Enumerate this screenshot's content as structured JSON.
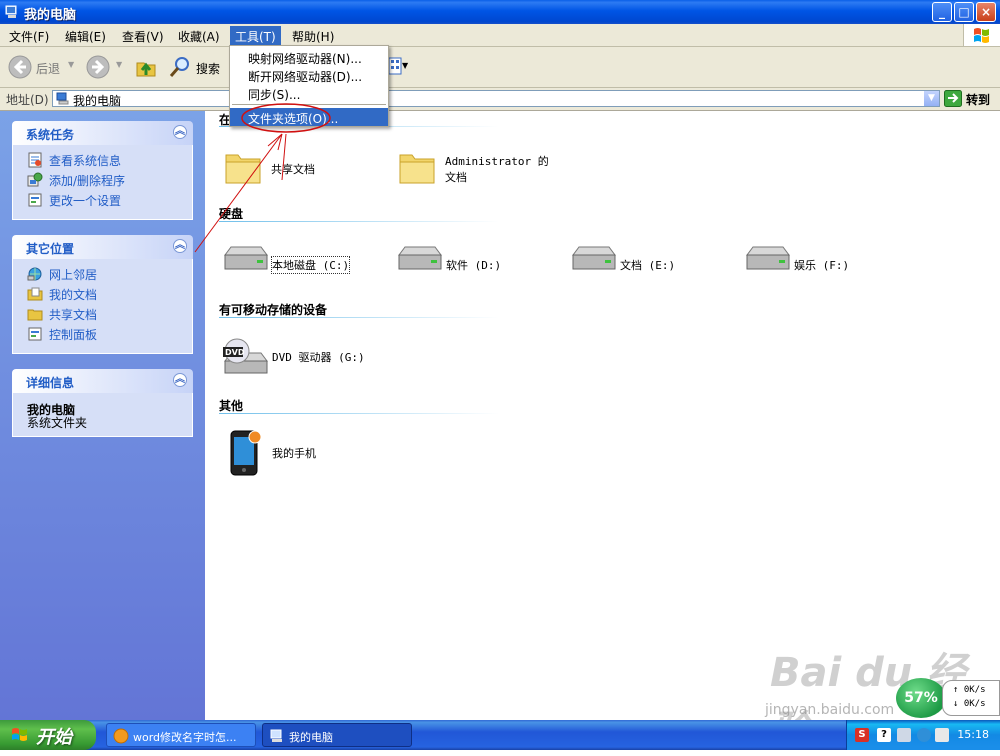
{
  "window": {
    "title": "我的电脑"
  },
  "menu": {
    "items": [
      {
        "label": "文件(F)"
      },
      {
        "label": "编辑(E)"
      },
      {
        "label": "查看(V)"
      },
      {
        "label": "收藏(A)"
      },
      {
        "label": "工具(T)"
      },
      {
        "label": "帮助(H)"
      }
    ]
  },
  "toolbar": {
    "back_label": "后退",
    "search_label": "搜索"
  },
  "address": {
    "label": "地址(D)",
    "value": "我的电脑",
    "go_label": "转到"
  },
  "tools_menu": {
    "items": [
      {
        "label": "映射网络驱动器(N)..."
      },
      {
        "label": "断开网络驱动器(D)..."
      },
      {
        "label": "同步(S)..."
      },
      {
        "label": "文件夹选项(O)..."
      }
    ],
    "highlighted_index": 3
  },
  "sidebar": {
    "system_tasks": {
      "title": "系统任务",
      "items": [
        {
          "label": "查看系统信息"
        },
        {
          "label": "添加/删除程序"
        },
        {
          "label": "更改一个设置"
        }
      ]
    },
    "other_places": {
      "title": "其它位置",
      "items": [
        {
          "label": "网上邻居"
        },
        {
          "label": "我的文档"
        },
        {
          "label": "共享文档"
        },
        {
          "label": "控制面板"
        }
      ]
    },
    "details": {
      "title": "详细信息",
      "name": "我的电脑",
      "desc": "系统文件夹"
    }
  },
  "content": {
    "groups": [
      {
        "title": "在",
        "items": [
          {
            "label": "共享文档"
          },
          {
            "label": "Administrator 的文档"
          }
        ]
      },
      {
        "title": "硬盘",
        "items": [
          {
            "label": "本地磁盘 (C:)"
          },
          {
            "label": "软件 (D:)"
          },
          {
            "label": "文档 (E:)"
          },
          {
            "label": "娱乐 (F:)"
          }
        ]
      },
      {
        "title": "有可移动存储的设备",
        "items": [
          {
            "label": "DVD 驱动器 (G:)"
          }
        ]
      },
      {
        "title": "其他",
        "items": [
          {
            "label": "我的手机"
          }
        ]
      }
    ]
  },
  "taskbar": {
    "start_label": "开始",
    "tasks": [
      {
        "label": "word修改名字时怎..."
      },
      {
        "label": "我的电脑"
      }
    ],
    "clock": "15:18"
  },
  "netspeed": {
    "badge": "57%",
    "up": "0K/s",
    "down": "0K/s"
  },
  "watermark": {
    "main": "Bai du 经验",
    "sub": "jingyan.baidu.com"
  }
}
